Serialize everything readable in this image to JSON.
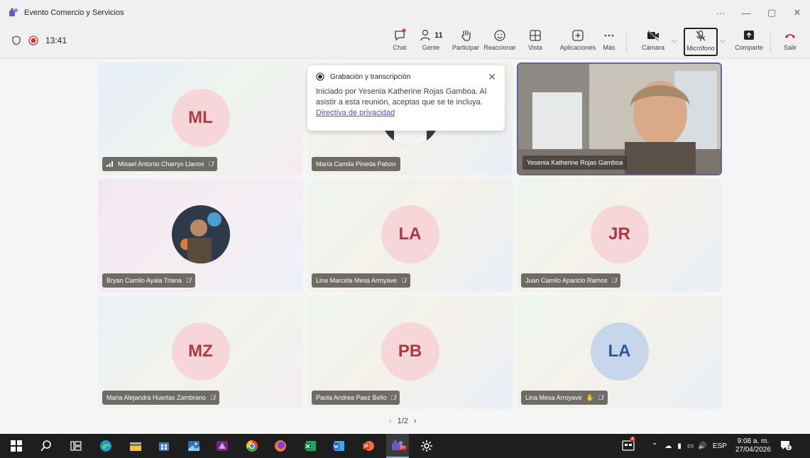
{
  "window": {
    "title": "Evento Comercio y Servicios"
  },
  "toolbar": {
    "timer": "13:41",
    "chat_label": "Chat",
    "people_label": "Gente",
    "people_count": "11",
    "raise_label": "Participar",
    "react_label": "Reaccionar",
    "view_label": "Vista",
    "apps_label": "Aplicaciones",
    "more_label": "Más",
    "camera_label": "Cámara",
    "mic_label": "Micrófono",
    "share_label": "Comparte",
    "leave_label": "Salir"
  },
  "popup": {
    "title": "Grabación y transcripción",
    "body": "Iniciado por Yesenia Katherine Rojas Gamboa. Al asistir a esta reunión, aceptas que se te incluya.",
    "link": "Directiva de privacidad"
  },
  "participants": [
    {
      "name": "Misael Antonio Charrys Llanos",
      "initials": "ML"
    },
    {
      "name": "María Camila Pineda Pabon",
      "initials": ""
    },
    {
      "name": "Yesenia Katherine Rojas Gamboa",
      "initials": ""
    },
    {
      "name": "Bryan Camilo Ayala Triana",
      "initials": ""
    },
    {
      "name": "Lina Marcela Mesa Arroyave",
      "initials": "LA"
    },
    {
      "name": "Juan Camilo Aparicio Ramos",
      "initials": "JR"
    },
    {
      "name": "Maria Alejandra Huertas Zambrano",
      "initials": "MZ"
    },
    {
      "name": "Paola Andrea Paez Bello",
      "initials": "PB"
    },
    {
      "name": "Lina Mesa Arroyave",
      "initials": "LA"
    }
  ],
  "pager": {
    "label": "1/2"
  },
  "taskbar": {
    "lang": "ESP",
    "time": "9:08 a. m.",
    "date": "27/04/2026",
    "notif_count": "1",
    "teams_badge": "9+",
    "tray_badge": "4"
  },
  "colors": {
    "record": "#d13438",
    "leave": "#c4314b",
    "accent": "#4f52b2"
  }
}
